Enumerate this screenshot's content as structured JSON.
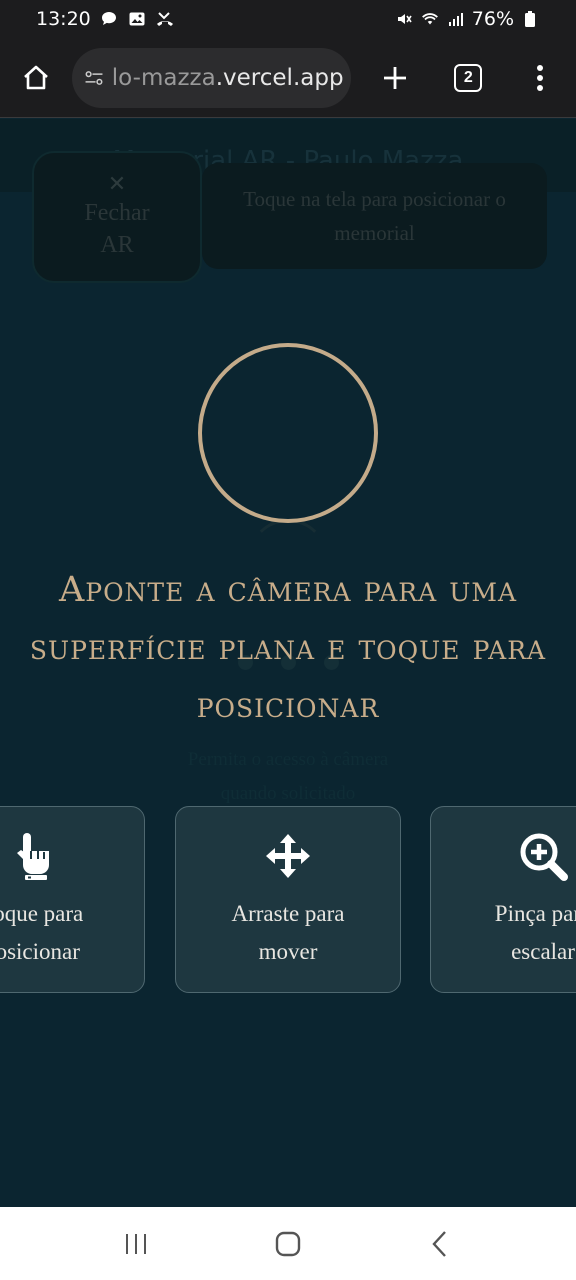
{
  "status_bar": {
    "time": "13:20",
    "battery": "76%",
    "left_icons": [
      "chat-icon",
      "image-icon",
      "missed-call-icon"
    ],
    "right_icons": [
      "mute-icon",
      "wifi-icon",
      "signal-icon",
      "battery-icon"
    ]
  },
  "browser": {
    "url_prefix": "lo-mazza",
    "url_suffix": ".vercel.app",
    "tab_count": "2"
  },
  "page": {
    "header_title": "Memorial AR - Paulo Mazza",
    "close_button": {
      "icon": "close-icon",
      "line1": "Fechar",
      "line2": "AR"
    },
    "hint": "Toque na tela para posicionar o memorial",
    "ghost_status": {
      "line1": "Permita o acesso à câmera",
      "line2": "quando solicitado"
    },
    "instruction": "Aponte a câmera para uma superfície plana e toque para posicionar",
    "cards": [
      {
        "icon": "tap-hand-icon",
        "line1": "Toque para",
        "line2": "posicionar"
      },
      {
        "icon": "move-arrows-icon",
        "line1": "Arraste para",
        "line2": "mover"
      },
      {
        "icon": "zoom-in-icon",
        "line1": "Pinça para",
        "line2": "escalar"
      }
    ]
  },
  "colors": {
    "background": "#0b2530",
    "accent": "#c8ad8a",
    "card_bg": "#1e3740"
  }
}
